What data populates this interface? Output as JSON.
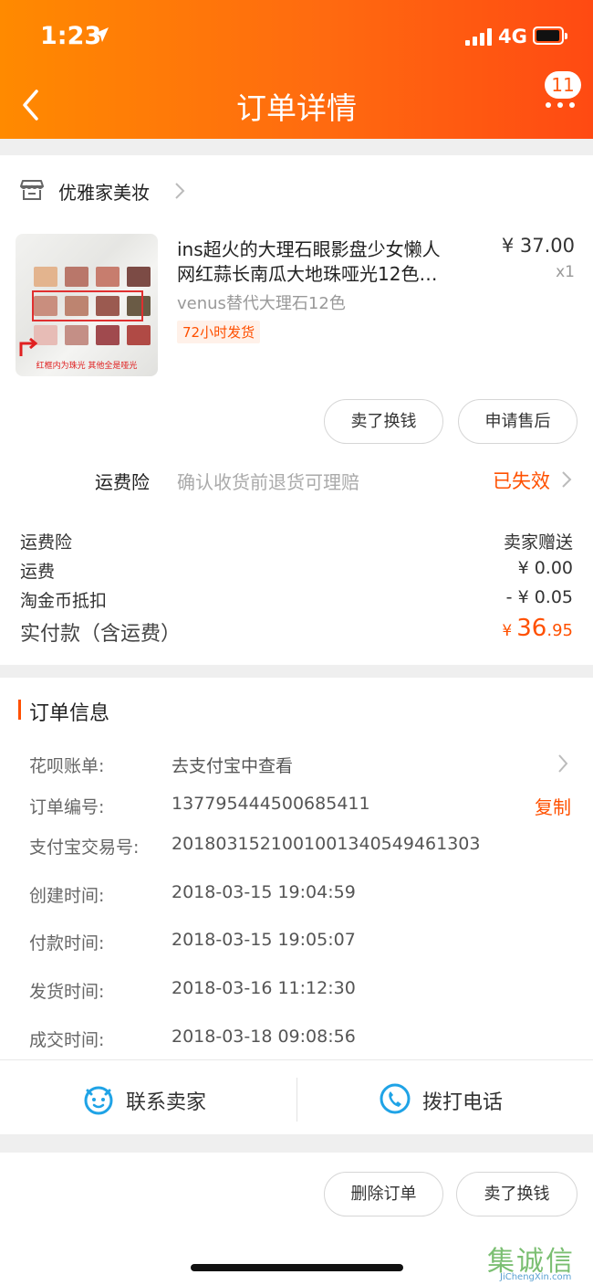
{
  "status_bar": {
    "time": "1:23",
    "network": "4G"
  },
  "nav": {
    "title": "订单详情",
    "badge": "11"
  },
  "shop": {
    "name": "优雅家美妆"
  },
  "product": {
    "title_line1": "ins超火的大理石眼影盘少女懒人",
    "title_line2": "网红蒜长南瓜大地珠哑光12色…",
    "price": "¥ 37.00",
    "qty": "x1",
    "sku": "venus替代大理石12色",
    "ship_tag": "72小时发货",
    "image_caption": "红框内为珠光 其他全是哑光"
  },
  "item_actions": {
    "sell": "卖了换钱",
    "aftersale": "申请售后"
  },
  "freight_insurance": {
    "label": "运费险",
    "desc": "确认收货前退货可理赔",
    "status": "已失效"
  },
  "fees": [
    {
      "label": "运费险",
      "value": "卖家赠送"
    },
    {
      "label": "运费",
      "value": "¥ 0.00"
    },
    {
      "label": "淘金币抵扣",
      "value": "- ¥ 0.05"
    }
  ],
  "total": {
    "label": "实付款（含运费）",
    "currency": "¥",
    "integer": "36",
    "decimal": ".95"
  },
  "order_info": {
    "title": "订单信息",
    "rows": [
      {
        "label": "花呗账单:",
        "value": "去支付宝中查看"
      },
      {
        "label": "订单编号:",
        "value": "137795444500685411"
      },
      {
        "label": "支付宝交易号:",
        "value": "2018031521001001340549461303"
      },
      {
        "label": "创建时间:",
        "value": "2018-03-15 19:04:59"
      },
      {
        "label": "付款时间:",
        "value": "2018-03-15 19:05:07"
      },
      {
        "label": "发货时间:",
        "value": "2018-03-16 11:12:30"
      },
      {
        "label": "成交时间:",
        "value": "2018-03-18 09:08:56"
      }
    ],
    "copy_label": "复制"
  },
  "contact": {
    "seller": "联系卖家",
    "phone": "拨打电话"
  },
  "bottom_actions": {
    "delete": "删除订单",
    "sell": "卖了换钱"
  },
  "watermark": {
    "chars": "集诚信",
    "url": "JiChengXin.com"
  },
  "colors": {
    "accent": "#ff5000",
    "header_start": "#ff8a00",
    "header_end": "#ff4a12",
    "contact_icon": "#1fa3e6"
  }
}
